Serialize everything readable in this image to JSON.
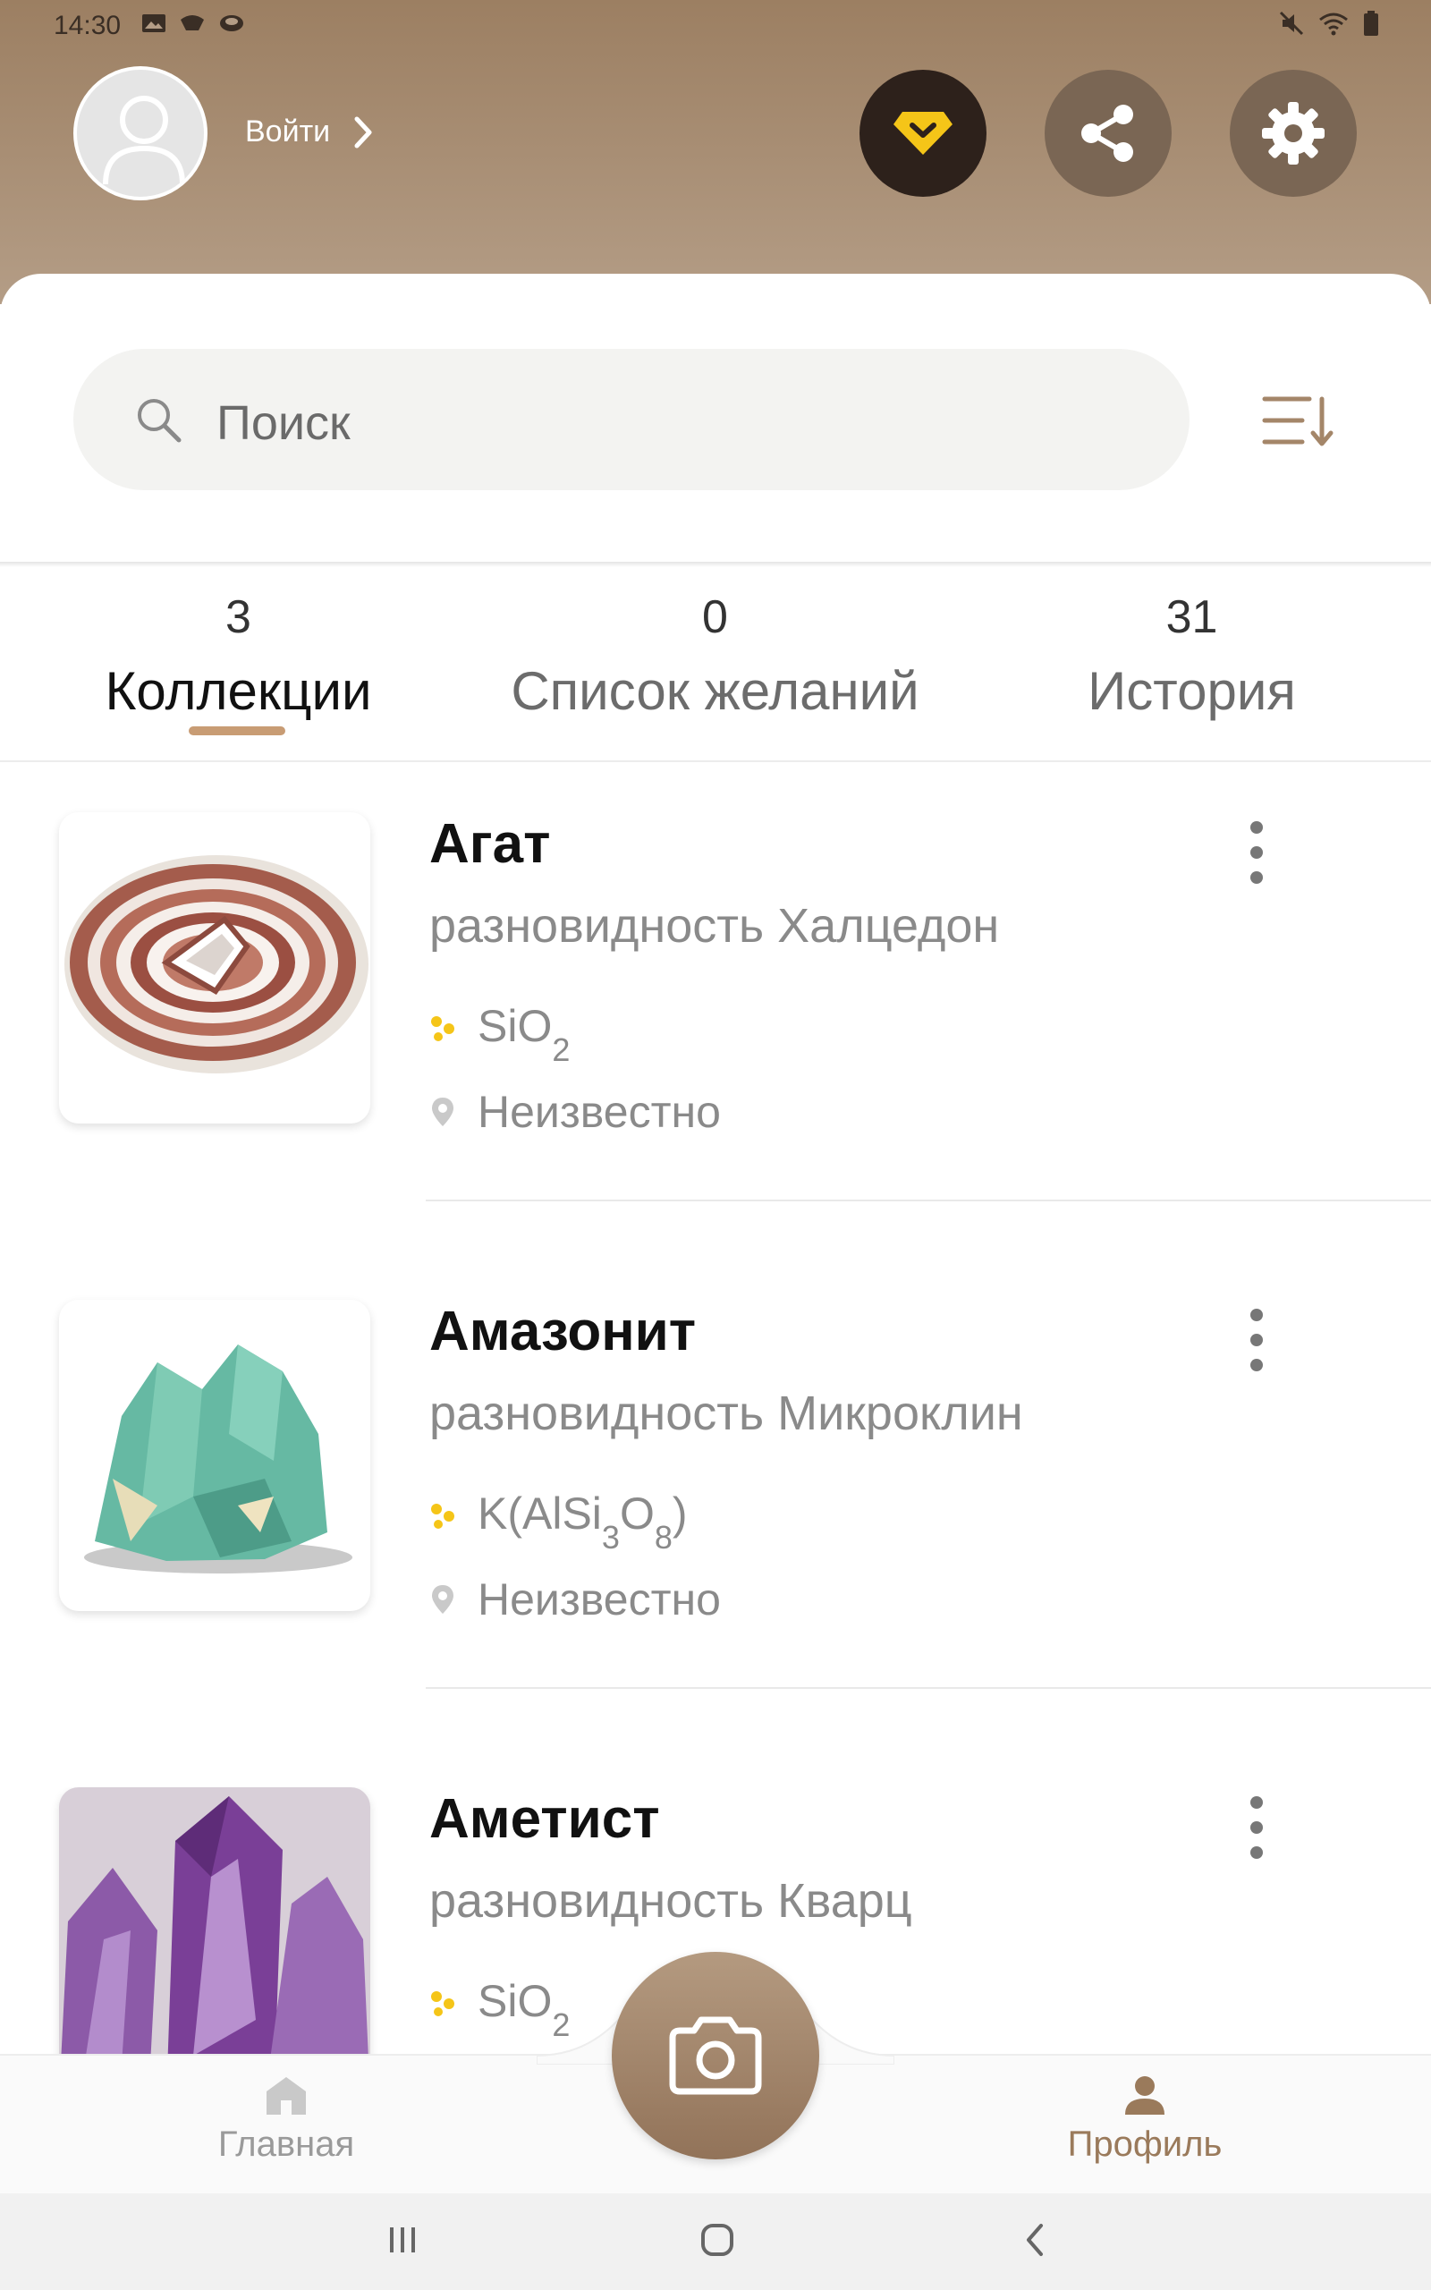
{
  "status_bar": {
    "time": "14:30"
  },
  "header": {
    "login_label": "Войти",
    "colors": {
      "premium": "#2d211b",
      "premium_accent": "#f5c518",
      "brown": "#7a6654"
    }
  },
  "search": {
    "placeholder": "Поиск"
  },
  "tabs": [
    {
      "count": "3",
      "label": "Коллекции",
      "active": true
    },
    {
      "count": "0",
      "label": "Список желаний",
      "active": false
    },
    {
      "count": "31",
      "label": "История",
      "active": false
    }
  ],
  "items": [
    {
      "name": "Агат",
      "variety": "разновидность Халцедон",
      "formula_parts": [
        "SiO",
        "2"
      ],
      "location": "Неизвестно"
    },
    {
      "name": "Амазонит",
      "variety": "разновидность Микроклин",
      "formula_parts": [
        "K(AlSi",
        "3",
        "O",
        "8",
        ")"
      ],
      "location": "Неизвестно"
    },
    {
      "name": "Аметист",
      "variety": "разновидность Кварц",
      "formula_parts": [
        "SiO",
        "2"
      ],
      "location": ""
    }
  ],
  "bottom_nav": {
    "home_label": "Главная",
    "profile_label": "Профиль"
  }
}
